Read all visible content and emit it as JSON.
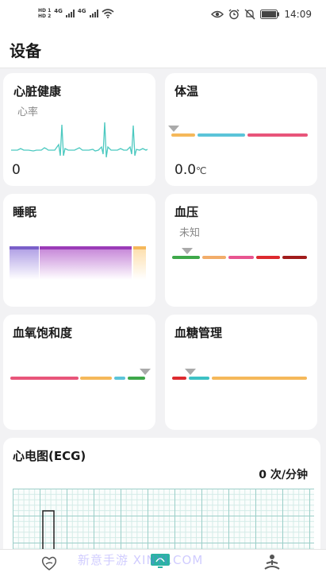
{
  "status_bar": {
    "hd1": "HD",
    "hd1_num": "1",
    "hd2": "HD",
    "hd2_num": "2",
    "net1": "4G",
    "net2": "4G",
    "battery": "100",
    "time": "14:09"
  },
  "header": {
    "title": "设备"
  },
  "cards": {
    "heart": {
      "title": "心脏健康",
      "subtitle": "心率",
      "value": "0"
    },
    "temperature": {
      "title": "体温",
      "value": "0.0",
      "unit": "℃",
      "marker_fraction": 0
    },
    "sleep": {
      "title": "睡眠"
    },
    "blood_pressure": {
      "title": "血压",
      "subtitle": "未知",
      "marker_fraction": 0.1
    },
    "spo2": {
      "title": "血氧饱和度",
      "marker_fraction": 1
    },
    "glucose": {
      "title": "血糖管理",
      "marker_fraction": 0.09
    },
    "ecg": {
      "title": "心电图(ECG)",
      "rate_value": "0",
      "rate_unit": "次/分钟"
    }
  },
  "colors": {
    "accent": "#2bb3a3",
    "heart_line": "#4cc9c0",
    "temp_bars": [
      "#f5b85a",
      "#5bc4d9",
      "#e8557a"
    ],
    "bp_bars": [
      "#3ea84a",
      "#f2ad6a",
      "#e85590",
      "#dd2a2f",
      "#a11c1c"
    ],
    "spo2_bars": [
      "#e8557a",
      "#f5b85a",
      "#5bc4d9",
      "#3ea84a"
    ],
    "glucose_bars": [
      "#dd2a2f",
      "#3cc1c4",
      "#f5b85a"
    ]
  },
  "tabbar": {
    "icons": [
      "heart-leaf-icon",
      "device-icon",
      "meditation-icon"
    ],
    "watermark": "新意手游 XINYI.COM"
  }
}
